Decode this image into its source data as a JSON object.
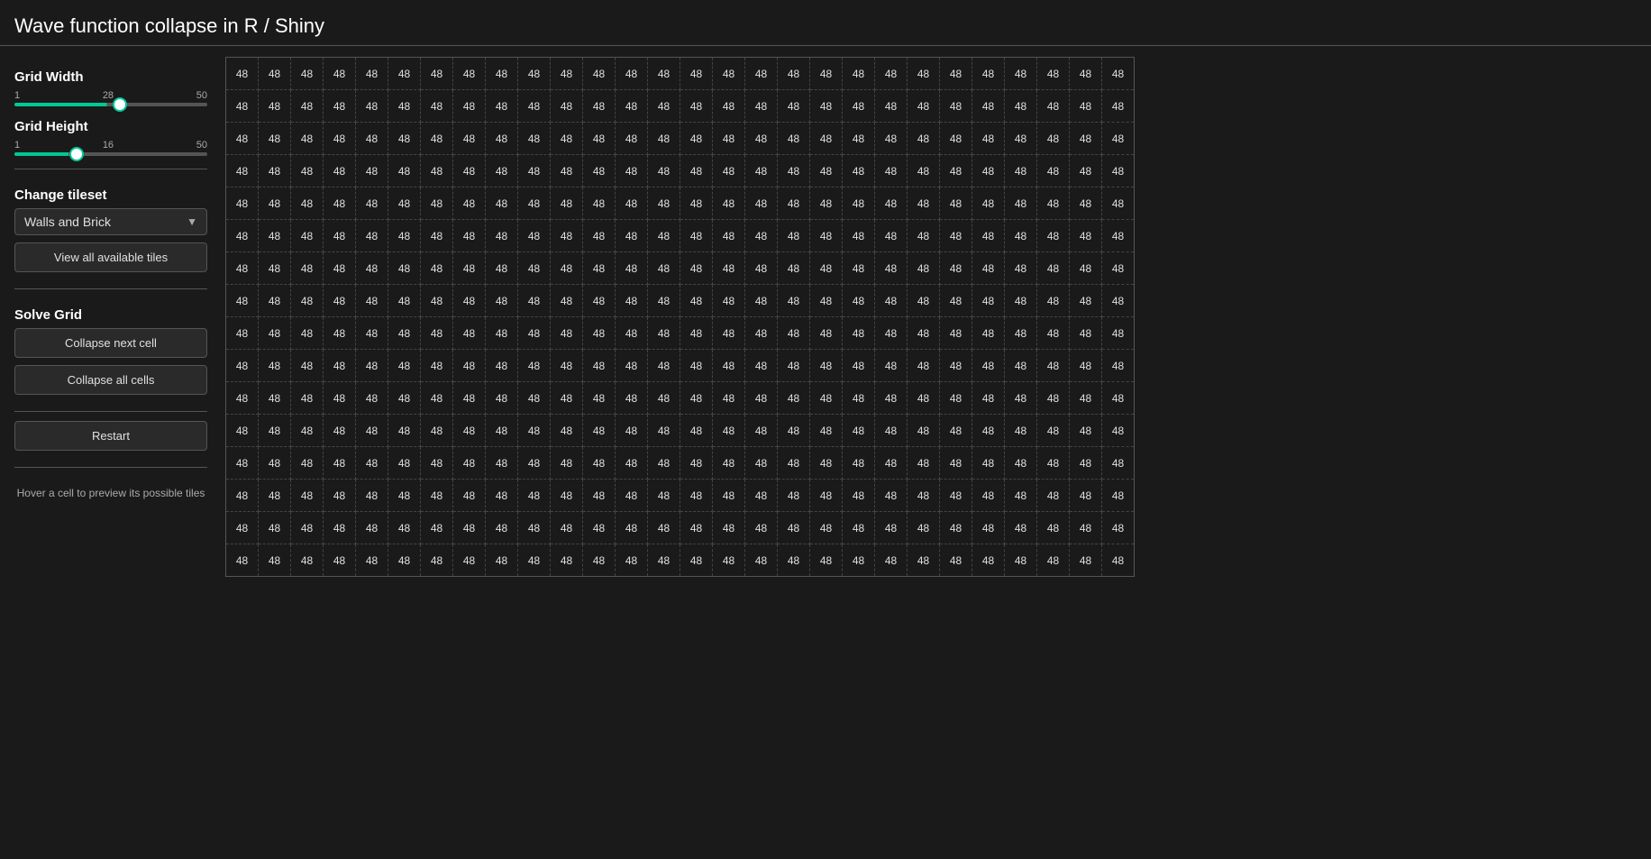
{
  "header": {
    "title": "Wave function collapse in R / Shiny"
  },
  "sidebar": {
    "grid_width_label": "Grid Width",
    "grid_width_min": "1",
    "grid_width_max": "50",
    "grid_width_value": 28,
    "grid_height_label": "Grid Height",
    "grid_height_min": "1",
    "grid_height_max": "50",
    "grid_height_value": 16,
    "change_tileset_label": "Change tileset",
    "tileset_value": "Walls and Brick",
    "view_tiles_btn": "View all available tiles",
    "solve_grid_label": "Solve Grid",
    "collapse_next_btn": "Collapse next cell",
    "collapse_all_btn": "Collapse all cells",
    "restart_btn": "Restart",
    "hover_hint": "Hover a cell to preview its possible tiles"
  },
  "grid": {
    "cell_value": "48",
    "rows": 16,
    "cols": 28
  }
}
